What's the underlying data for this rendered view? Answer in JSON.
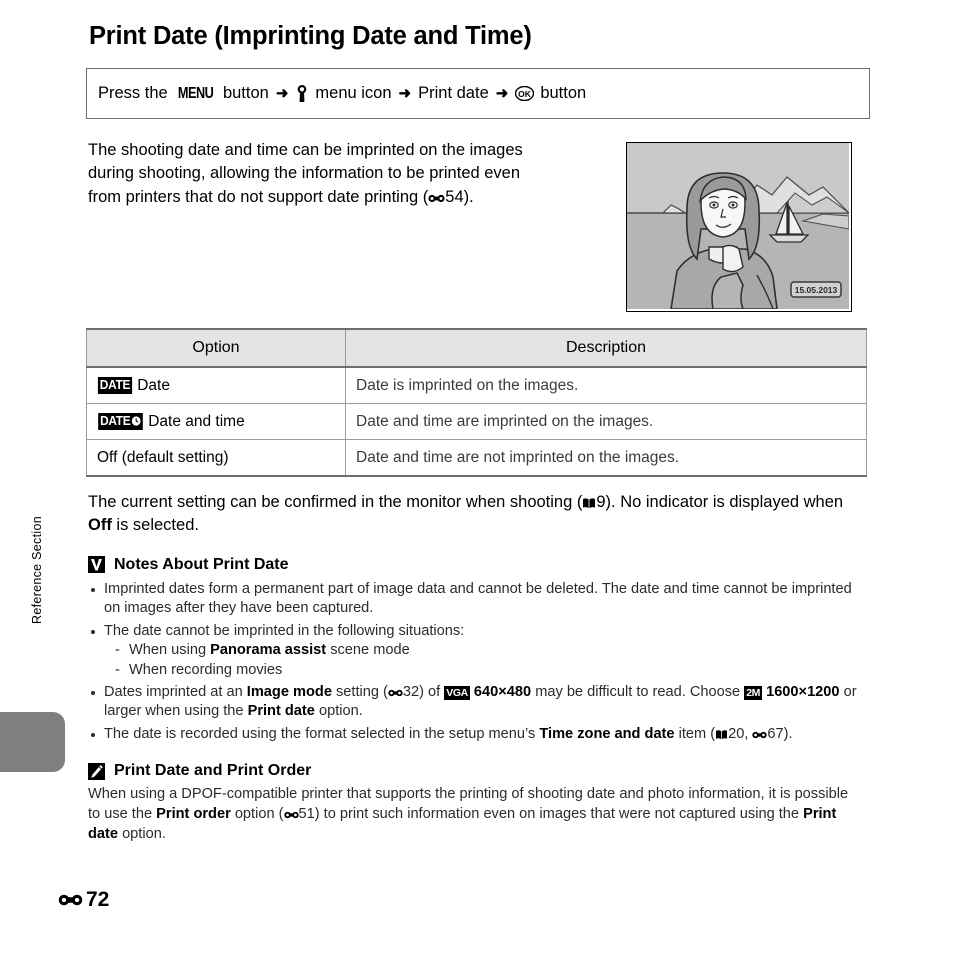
{
  "side": {
    "section_label": "Reference Section"
  },
  "header": {
    "title": "Print Date (Imprinting Date and Time)"
  },
  "menu_path": {
    "press_the": "Press the",
    "menu_button_label": "MENU",
    "button_word": "button",
    "arrow": "➜",
    "setup_menu_icon": "wrench-icon",
    "menu_icon_label": "menu icon",
    "item": "Print date",
    "ok_icon": "ok-button-icon",
    "ok_button_word": "button"
  },
  "intro": {
    "line1": "The shooting date and time can be imprinted on the images",
    "line2": "during shooting, allowing the information to be printed even",
    "line3_pre": "from printers that do not support date printing (",
    "line3_ref": "54",
    "line3_post": ")."
  },
  "photo": {
    "alt": "sample photo of woman at seaside with sailboat",
    "date_stamp": "15.05.2013"
  },
  "table": {
    "headers": [
      "Option",
      "Description"
    ],
    "rows": [
      {
        "icon": "DATE",
        "icon_has_clock": false,
        "option": "Date",
        "description": "Date is imprinted on the images."
      },
      {
        "icon": "DATE",
        "icon_has_clock": true,
        "option": "Date and time",
        "description": "Date and time are imprinted on the images."
      },
      {
        "icon": "",
        "icon_has_clock": false,
        "option": "Off (default setting)",
        "description": "Date and time are not imprinted on the images."
      }
    ]
  },
  "after_table": {
    "part1": "The current setting can be confirmed in the monitor when shooting (",
    "ref_book": "9",
    "part2": "). No indicator is displayed when ",
    "bold_off": "Off",
    "part3": " is selected."
  },
  "notes": {
    "icon": "caution-icon",
    "title": "Notes About Print Date",
    "bullet1": "Imprinted dates form a permanent part of image data and cannot be deleted. The date and time cannot be imprinted on images after they have been captured.",
    "bullet2": "The date cannot be imprinted in the following situations:",
    "bullet2_sub1_pre": "When using ",
    "bullet2_sub1_bold": "Panorama assist",
    "bullet2_sub1_post": " scene mode",
    "bullet2_sub2": "When recording movies",
    "bullet3_pre": "Dates imprinted at an ",
    "bullet3_bold1": "Image mode",
    "bullet3_mid1": " setting (",
    "bullet3_ref1": "32",
    "bullet3_mid2": ") of ",
    "bullet3_badge1": "VGA",
    "bullet3_bold2": "640×480",
    "bullet3_mid3": " may be difficult to read. Choose ",
    "bullet3_badge2": "2M",
    "bullet3_bold3": "1600×1200",
    "bullet3_mid4": " or larger when using the ",
    "bullet3_bold4": "Print date",
    "bullet3_post": " option.",
    "bullet4_pre": "The date is recorded using the format selected in the setup menu’s ",
    "bullet4_bold": "Time zone and date",
    "bullet4_mid": " item (",
    "bullet4_ref_book": "20",
    "bullet4_sep": ", ",
    "bullet4_ref_e": "67",
    "bullet4_post": ")."
  },
  "tip": {
    "icon": "pencil-icon",
    "title": "Print Date and Print Order",
    "text_pre": "When using a DPOF-compatible printer that supports the printing of shooting date and photo information, it is possible to use the ",
    "bold1": "Print order",
    "mid1": " option (",
    "ref": "51",
    "mid2": ") to print such information even on images that were not captured using the ",
    "bold2": "Print date",
    "post": " option."
  },
  "footer": {
    "page_prefix_icon": "e-section-icon",
    "page_number": "72"
  },
  "colors": {
    "tab_gray": "#808080",
    "table_header_bg": "#e4e4e4",
    "rule_gray": "#6e6e6e"
  }
}
